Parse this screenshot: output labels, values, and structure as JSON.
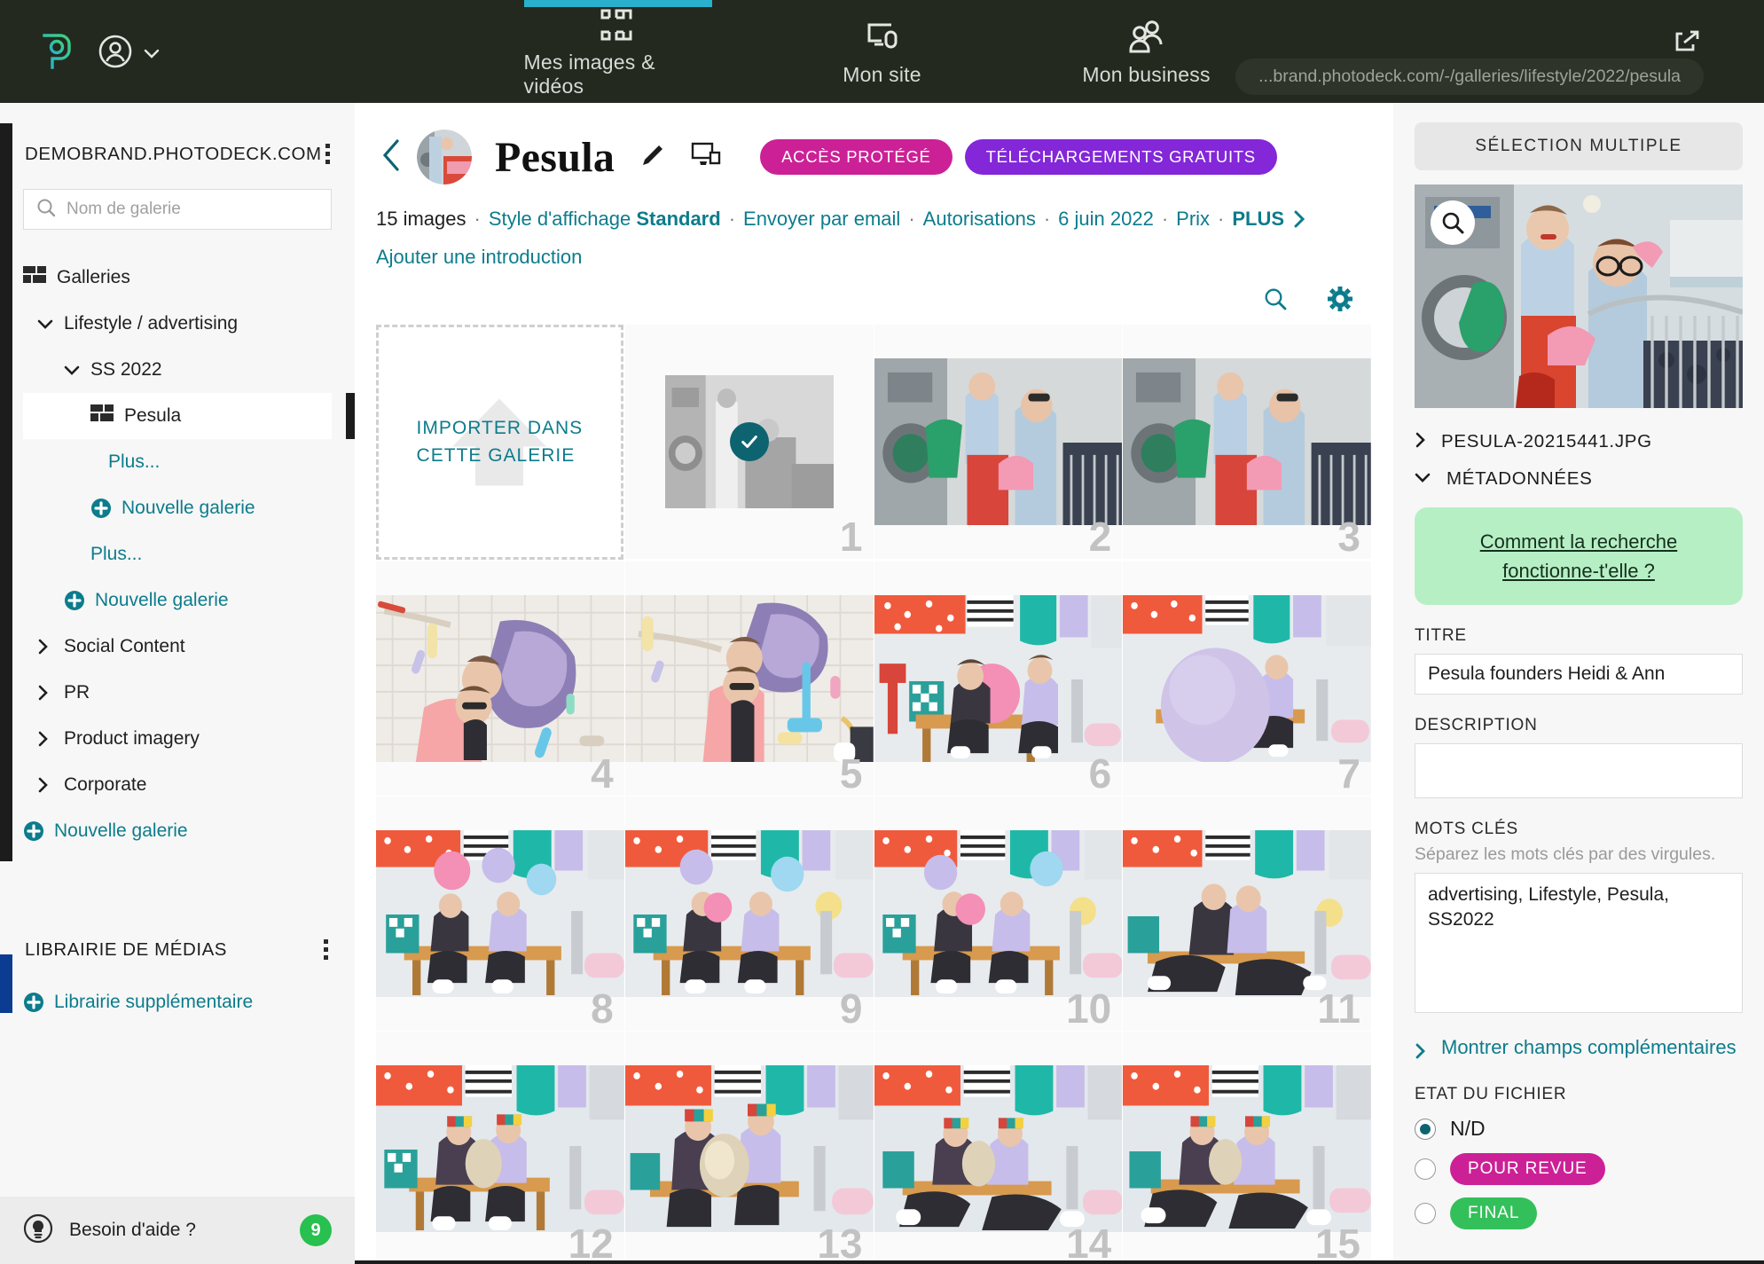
{
  "topbar": {
    "logo_icon": "photodeck-logo-icon",
    "account_icon": "account-circle-icon",
    "chevron_icon": "chevron-down-icon",
    "nav": [
      {
        "label": "Mes images & vidéos",
        "icon": "grid-squares-icon",
        "active": true
      },
      {
        "label": "Mon site",
        "icon": "monitor-icon",
        "active": false
      },
      {
        "label": "Mon business",
        "icon": "people-icon",
        "active": false
      }
    ],
    "url": "...brand.photodeck.com/-/galleries/lifestyle/2022/pesula",
    "external_link_icon": "external-link-icon",
    "active_indicator_color": "#2ab0cd"
  },
  "sidebar": {
    "site_title": "DEMOBRAND.PHOTODECK.COM",
    "kebab_icon": "kebab-menu-icon",
    "search_placeholder": "Nom de galerie",
    "search_icon": "search-icon",
    "tree": [
      {
        "label": "Galleries",
        "type": "root",
        "icon": "galleries-icon",
        "indent": 0
      },
      {
        "label": "Lifestyle / advertising",
        "type": "folder-open",
        "icon": "chevron-down-icon",
        "indent": 1
      },
      {
        "label": "SS 2022",
        "type": "folder-open",
        "icon": "chevron-down-icon",
        "indent": 2
      },
      {
        "label": "Pesula",
        "type": "gallery",
        "icon": "galleries-icon",
        "indent": 3,
        "selected": true
      },
      {
        "label": "Plus...",
        "type": "link",
        "indent": 4
      },
      {
        "label": "Nouvelle galerie",
        "type": "add",
        "icon": "plus-circle-icon",
        "indent": 3
      },
      {
        "label": "Plus...",
        "type": "link",
        "indent": 3
      },
      {
        "label": "Nouvelle galerie",
        "type": "add",
        "icon": "plus-circle-icon",
        "indent": 2
      },
      {
        "label": "Social Content",
        "type": "folder",
        "icon": "chevron-right-icon",
        "indent": 1
      },
      {
        "label": "PR",
        "type": "folder",
        "icon": "chevron-right-icon",
        "indent": 1
      },
      {
        "label": "Product imagery",
        "type": "folder",
        "icon": "chevron-right-icon",
        "indent": 1
      },
      {
        "label": "Corporate",
        "type": "folder",
        "icon": "chevron-right-icon",
        "indent": 1
      },
      {
        "label": "Nouvelle galerie",
        "type": "add",
        "icon": "plus-circle-icon",
        "indent": 0
      }
    ],
    "media_library_title": "LIBRAIRIE DE MÉDIAS",
    "media_library_add": "Librairie supplémentaire",
    "help_label": "Besoin d'aide ?",
    "help_icon": "lightbulb-icon",
    "help_count": "9",
    "accent_dark": "#1c1c1c",
    "accent_blue": "#0b3c91",
    "link_color": "#0c7c8c"
  },
  "gallery": {
    "back_icon": "chevron-left-icon",
    "avatar_name": "gallery-cover-avatar",
    "title": "Pesula",
    "edit_icon": "pencil-icon",
    "preview_icon": "monitor-preview-icon",
    "badges": [
      {
        "label": "ACCÈS PROTÉGÉ",
        "color": "#cc2196"
      },
      {
        "label": "TÉLÉCHARGEMENTS GRATUITS",
        "color": "#8327d8"
      }
    ],
    "meta": {
      "count": "15 images",
      "display_style_label": "Style d'affichage",
      "display_style_value": "Standard",
      "send_email": "Envoyer par email",
      "permissions": "Autorisations",
      "date": "6 juin 2022",
      "price": "Prix",
      "more": "PLUS",
      "more_chevron_icon": "chevron-right-icon"
    },
    "add_intro": "Ajouter une introduction",
    "tools": [
      {
        "name": "search-icon"
      },
      {
        "name": "gear-icon"
      }
    ],
    "upload_tile": {
      "line1": "IMPORTER DANS",
      "line2": "CETTE GALERIE",
      "icon": "upload-arrow-icon"
    },
    "thumbnails": [
      {
        "num": "1",
        "selected": true,
        "style": "bw-small",
        "check_icon": "check-circle-icon"
      },
      {
        "num": "2",
        "selected": false,
        "style": "laundry"
      },
      {
        "num": "3",
        "selected": false,
        "style": "laundry"
      },
      {
        "num": "4",
        "selected": false,
        "style": "floor"
      },
      {
        "num": "5",
        "selected": false,
        "style": "floor"
      },
      {
        "num": "6",
        "selected": false,
        "style": "balloon-pink"
      },
      {
        "num": "7",
        "selected": false,
        "style": "balloon-big"
      },
      {
        "num": "8",
        "selected": false,
        "style": "bench"
      },
      {
        "num": "9",
        "selected": false,
        "style": "bench"
      },
      {
        "num": "10",
        "selected": false,
        "style": "bench"
      },
      {
        "num": "11",
        "selected": false,
        "style": "bench"
      },
      {
        "num": "12",
        "selected": false,
        "style": "hats"
      },
      {
        "num": "13",
        "selected": false,
        "style": "hats"
      },
      {
        "num": "14",
        "selected": false,
        "style": "hats"
      },
      {
        "num": "15",
        "selected": false,
        "style": "hats"
      }
    ]
  },
  "right_panel": {
    "multi_select": "SÉLECTION MULTIPLE",
    "zoom_icon": "magnifier-icon",
    "preview_name": "selected-image-preview",
    "filename": "PESULA-20215441.JPG",
    "filename_chevron": "chevron-right-icon",
    "metadata_header": "MÉTADONNÉES",
    "metadata_chevron": "chevron-down-icon",
    "help_link": "Comment la recherche fonctionne-t'elle ?",
    "title_label": "TITRE",
    "title_value": "Pesula founders Heidi & Ann",
    "description_label": "DESCRIPTION",
    "description_value": "",
    "keywords_label": "MOTS CLÉS",
    "keywords_hint": "Séparez les mots clés par des virgules.",
    "keywords_value": "advertising, Lifestyle, Pesula, SS2022",
    "more_fields": "Montrer champs complémentaires",
    "more_fields_chevron": "chevron-right-icon",
    "file_state_label": "ETAT DU FICHIER",
    "file_states": [
      {
        "label": "N/D",
        "selected": true,
        "pill": false
      },
      {
        "label": "POUR REVUE",
        "selected": false,
        "pill": true,
        "color": "#cc2196"
      },
      {
        "label": "FINAL",
        "selected": false,
        "pill": true,
        "color": "#33c05a"
      }
    ]
  }
}
